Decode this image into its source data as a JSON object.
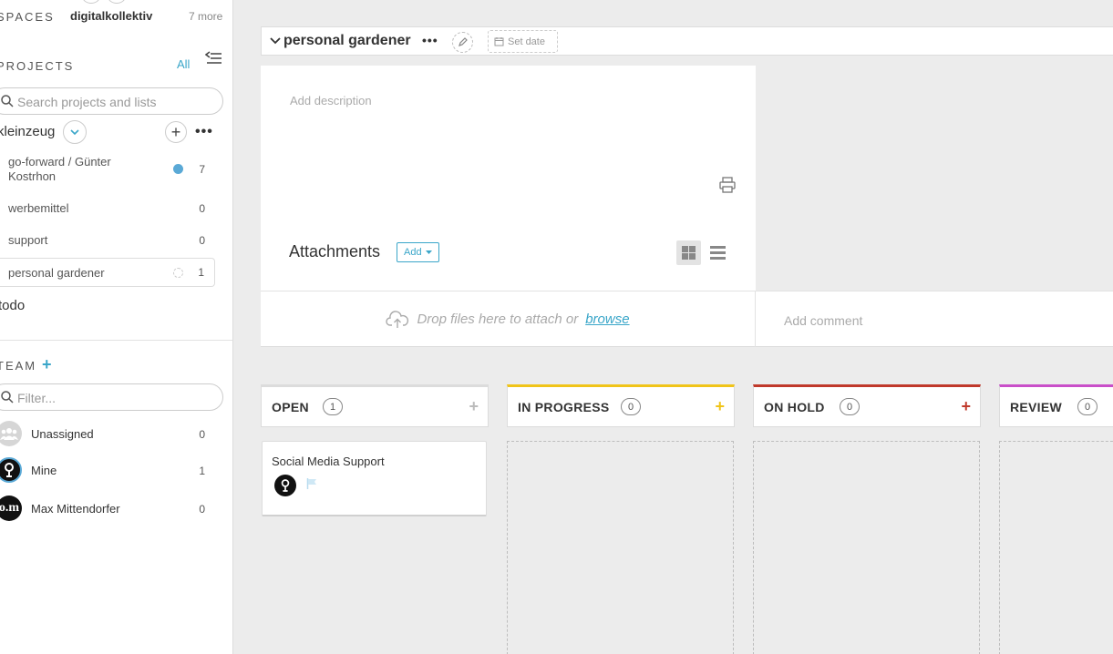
{
  "sidebar": {
    "spaces": {
      "label": "SPACES",
      "current": "digitalkollektiv",
      "more": "7 more"
    },
    "projects": {
      "label": "PROJECTS",
      "all_link": "All",
      "search_placeholder": "Search projects and lists",
      "group": {
        "name": "kleinzeug"
      },
      "items": [
        {
          "label": "go-forward / Günter Kostrhon",
          "count": "7",
          "status": "dot-filled",
          "dot_color": "#5aa9d6"
        },
        {
          "label": "werbemittel",
          "count": "0"
        },
        {
          "label": "support",
          "count": "0"
        },
        {
          "label": "personal gardener",
          "count": "1",
          "status": "dot-empty",
          "active": true
        }
      ],
      "todo": "todo"
    },
    "team": {
      "label": "TEAM",
      "filter_placeholder": "Filter...",
      "members": [
        {
          "name": "Unassigned",
          "count": "0",
          "avatar": "group-icon"
        },
        {
          "name": "Mine",
          "count": "1",
          "avatar": "user-avatar-dark"
        },
        {
          "name": "Max Mittendorfer",
          "count": "0",
          "avatar": "user-avatar-initials",
          "initials": "o.m"
        }
      ]
    }
  },
  "header": {
    "title": "personal gardener",
    "more": "•••",
    "set_date": "Set date"
  },
  "details": {
    "description_placeholder": "Add description",
    "attachments_title": "Attachments",
    "attachments_add": "Add",
    "drop_text": "Drop files here to attach or",
    "drop_link": "browse",
    "comment_placeholder": "Add comment"
  },
  "board": {
    "columns": [
      {
        "title": "OPEN",
        "count": "1",
        "accent": "#dcdcdc",
        "add_color": "#bbbbbb"
      },
      {
        "title": "IN PROGRESS",
        "count": "0",
        "accent": "#f0c419",
        "add_color": "#f0c419"
      },
      {
        "title": "ON HOLD",
        "count": "0",
        "accent": "#c0392b",
        "add_color": "#c0392b"
      },
      {
        "title": "REVIEW",
        "count": "0",
        "accent": "#c94fc9",
        "add_color": "#c94fc9"
      }
    ],
    "cards": [
      {
        "title": "Social Media Support",
        "column": "OPEN"
      }
    ]
  },
  "colors": {
    "accent": "#3aa6c9"
  }
}
